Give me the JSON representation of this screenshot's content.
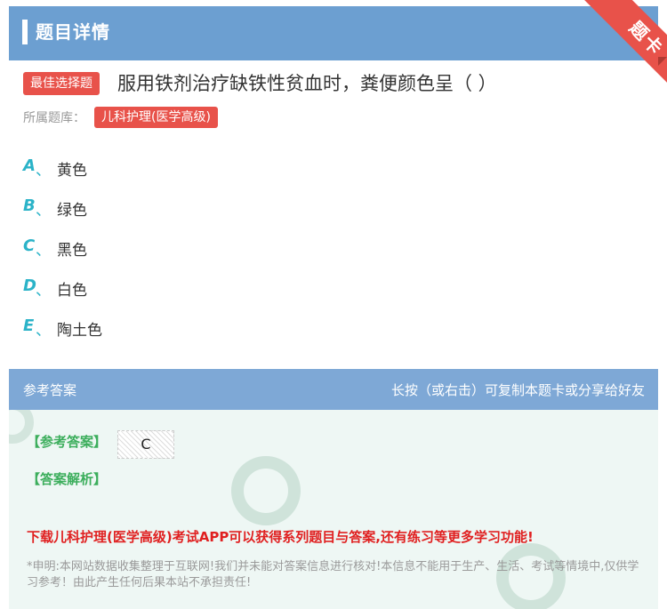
{
  "header": {
    "title": "题目详情",
    "corner_label": "题卡"
  },
  "question": {
    "type_tag": "最佳选择题",
    "text": "服用铁剂治疗缺铁性贫血时，粪便颜色呈（ ）",
    "bank_label": "所属题库：",
    "bank_name": "儿科护理(医学高级)"
  },
  "options": [
    {
      "letter": "A",
      "sep": "、",
      "text": "黄色"
    },
    {
      "letter": "B",
      "sep": "、",
      "text": "绿色"
    },
    {
      "letter": "C",
      "sep": "、",
      "text": "黑色"
    },
    {
      "letter": "D",
      "sep": "、",
      "text": "白色"
    },
    {
      "letter": "E",
      "sep": "、",
      "text": "陶土色"
    }
  ],
  "answer_section": {
    "title": "参考答案",
    "hint": "长按（或右击）可复制本题卡或分享给好友",
    "ref_label": "【参考答案】",
    "ref_value": "C",
    "analysis_label": "【答案解析】",
    "promo": "下载儿科护理(医学高级)考试APP可以获得系列题目与答案,还有练习等更多学习功能!",
    "disclaimer": "*申明:本网站数据收集整理于互联网!我们并未能对答案信息进行核对!本信息不能用于生产、生活、考试等情境中,仅供学习参考！由此产生任何后果本站不承担责任!"
  },
  "colors": {
    "header": "#6c9fd1",
    "accent_red": "#e8524a",
    "option_letter": "#2bb3c8",
    "answer_green": "#3cae5c",
    "promo_red": "#e02020"
  }
}
